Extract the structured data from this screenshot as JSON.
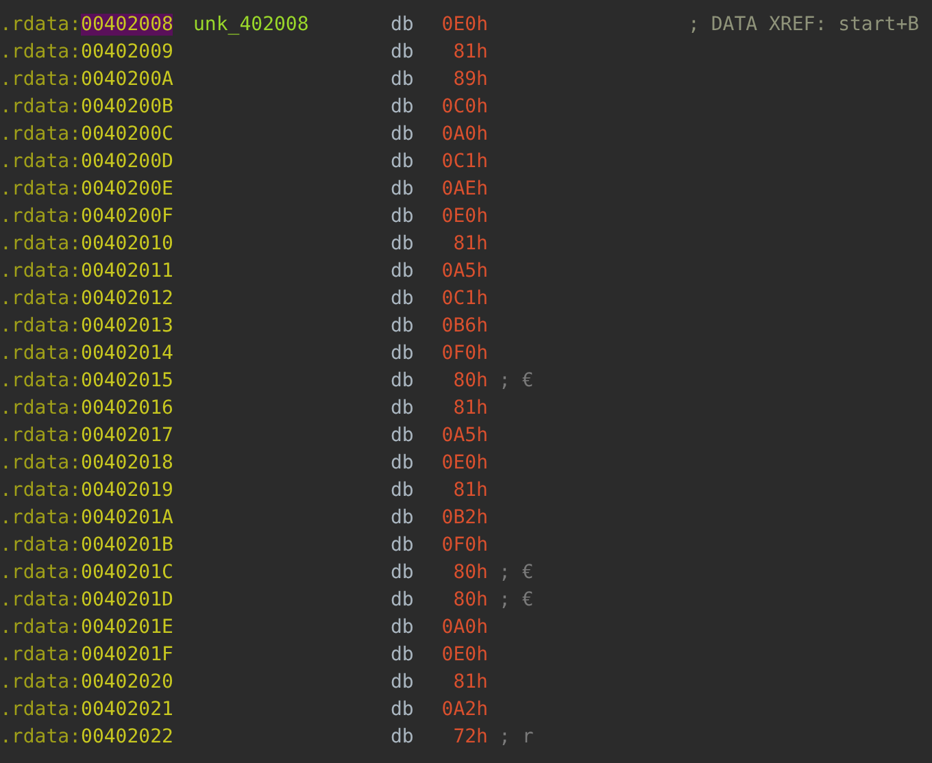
{
  "rows": [
    {
      "kind": "data",
      "segment": ".rdata:",
      "address": "00402008",
      "highlighted": true,
      "label": "unk_402008",
      "mnemonic": "db",
      "operand": "0E0h",
      "comment": "; DATA XREF: start+B"
    },
    {
      "kind": "data",
      "segment": ".rdata:",
      "address": "00402009",
      "highlighted": false,
      "mnemonic": "db",
      "operand": "81h"
    },
    {
      "kind": "data",
      "segment": ".rdata:",
      "address": "0040200A",
      "highlighted": false,
      "mnemonic": "db",
      "operand": "89h"
    },
    {
      "kind": "data",
      "segment": ".rdata:",
      "address": "0040200B",
      "highlighted": false,
      "mnemonic": "db",
      "operand": "0C0h"
    },
    {
      "kind": "data",
      "segment": ".rdata:",
      "address": "0040200C",
      "highlighted": false,
      "mnemonic": "db",
      "operand": "0A0h"
    },
    {
      "kind": "data",
      "segment": ".rdata:",
      "address": "0040200D",
      "highlighted": false,
      "mnemonic": "db",
      "operand": "0C1h"
    },
    {
      "kind": "data",
      "segment": ".rdata:",
      "address": "0040200E",
      "highlighted": false,
      "mnemonic": "db",
      "operand": "0AEh"
    },
    {
      "kind": "data",
      "segment": ".rdata:",
      "address": "0040200F",
      "highlighted": false,
      "mnemonic": "db",
      "operand": "0E0h"
    },
    {
      "kind": "data",
      "segment": ".rdata:",
      "address": "00402010",
      "highlighted": false,
      "mnemonic": "db",
      "operand": "81h"
    },
    {
      "kind": "data",
      "segment": ".rdata:",
      "address": "00402011",
      "highlighted": false,
      "mnemonic": "db",
      "operand": "0A5h"
    },
    {
      "kind": "data",
      "segment": ".rdata:",
      "address": "00402012",
      "highlighted": false,
      "mnemonic": "db",
      "operand": "0C1h"
    },
    {
      "kind": "data",
      "segment": ".rdata:",
      "address": "00402013",
      "highlighted": false,
      "mnemonic": "db",
      "operand": "0B6h"
    },
    {
      "kind": "data",
      "segment": ".rdata:",
      "address": "00402014",
      "highlighted": false,
      "mnemonic": "db",
      "operand": "0F0h"
    },
    {
      "kind": "data",
      "segment": ".rdata:",
      "address": "00402015",
      "highlighted": false,
      "mnemonic": "db",
      "operand": "80h",
      "char": "; €"
    },
    {
      "kind": "data",
      "segment": ".rdata:",
      "address": "00402016",
      "highlighted": false,
      "mnemonic": "db",
      "operand": "81h"
    },
    {
      "kind": "data",
      "segment": ".rdata:",
      "address": "00402017",
      "highlighted": false,
      "mnemonic": "db",
      "operand": "0A5h"
    },
    {
      "kind": "data",
      "segment": ".rdata:",
      "address": "00402018",
      "highlighted": false,
      "mnemonic": "db",
      "operand": "0E0h"
    },
    {
      "kind": "data",
      "segment": ".rdata:",
      "address": "00402019",
      "highlighted": false,
      "mnemonic": "db",
      "operand": "81h"
    },
    {
      "kind": "data",
      "segment": ".rdata:",
      "address": "0040201A",
      "highlighted": false,
      "mnemonic": "db",
      "operand": "0B2h"
    },
    {
      "kind": "data",
      "segment": ".rdata:",
      "address": "0040201B",
      "highlighted": false,
      "mnemonic": "db",
      "operand": "0F0h"
    },
    {
      "kind": "data",
      "segment": ".rdata:",
      "address": "0040201C",
      "highlighted": false,
      "mnemonic": "db",
      "operand": "80h",
      "char": "; €"
    },
    {
      "kind": "data",
      "segment": ".rdata:",
      "address": "0040201D",
      "highlighted": false,
      "mnemonic": "db",
      "operand": "80h",
      "char": "; €"
    },
    {
      "kind": "data",
      "segment": ".rdata:",
      "address": "0040201E",
      "highlighted": false,
      "mnemonic": "db",
      "operand": "0A0h"
    },
    {
      "kind": "data",
      "segment": ".rdata:",
      "address": "0040201F",
      "highlighted": false,
      "mnemonic": "db",
      "operand": "0E0h"
    },
    {
      "kind": "data",
      "segment": ".rdata:",
      "address": "00402020",
      "highlighted": false,
      "mnemonic": "db",
      "operand": "81h"
    },
    {
      "kind": "data",
      "segment": ".rdata:",
      "address": "00402021",
      "highlighted": false,
      "mnemonic": "db",
      "operand": "0A2h"
    },
    {
      "kind": "data",
      "segment": ".rdata:",
      "address": "00402022",
      "highlighted": false,
      "mnemonic": "db",
      "operand": "72h",
      "char": "; r"
    }
  ]
}
